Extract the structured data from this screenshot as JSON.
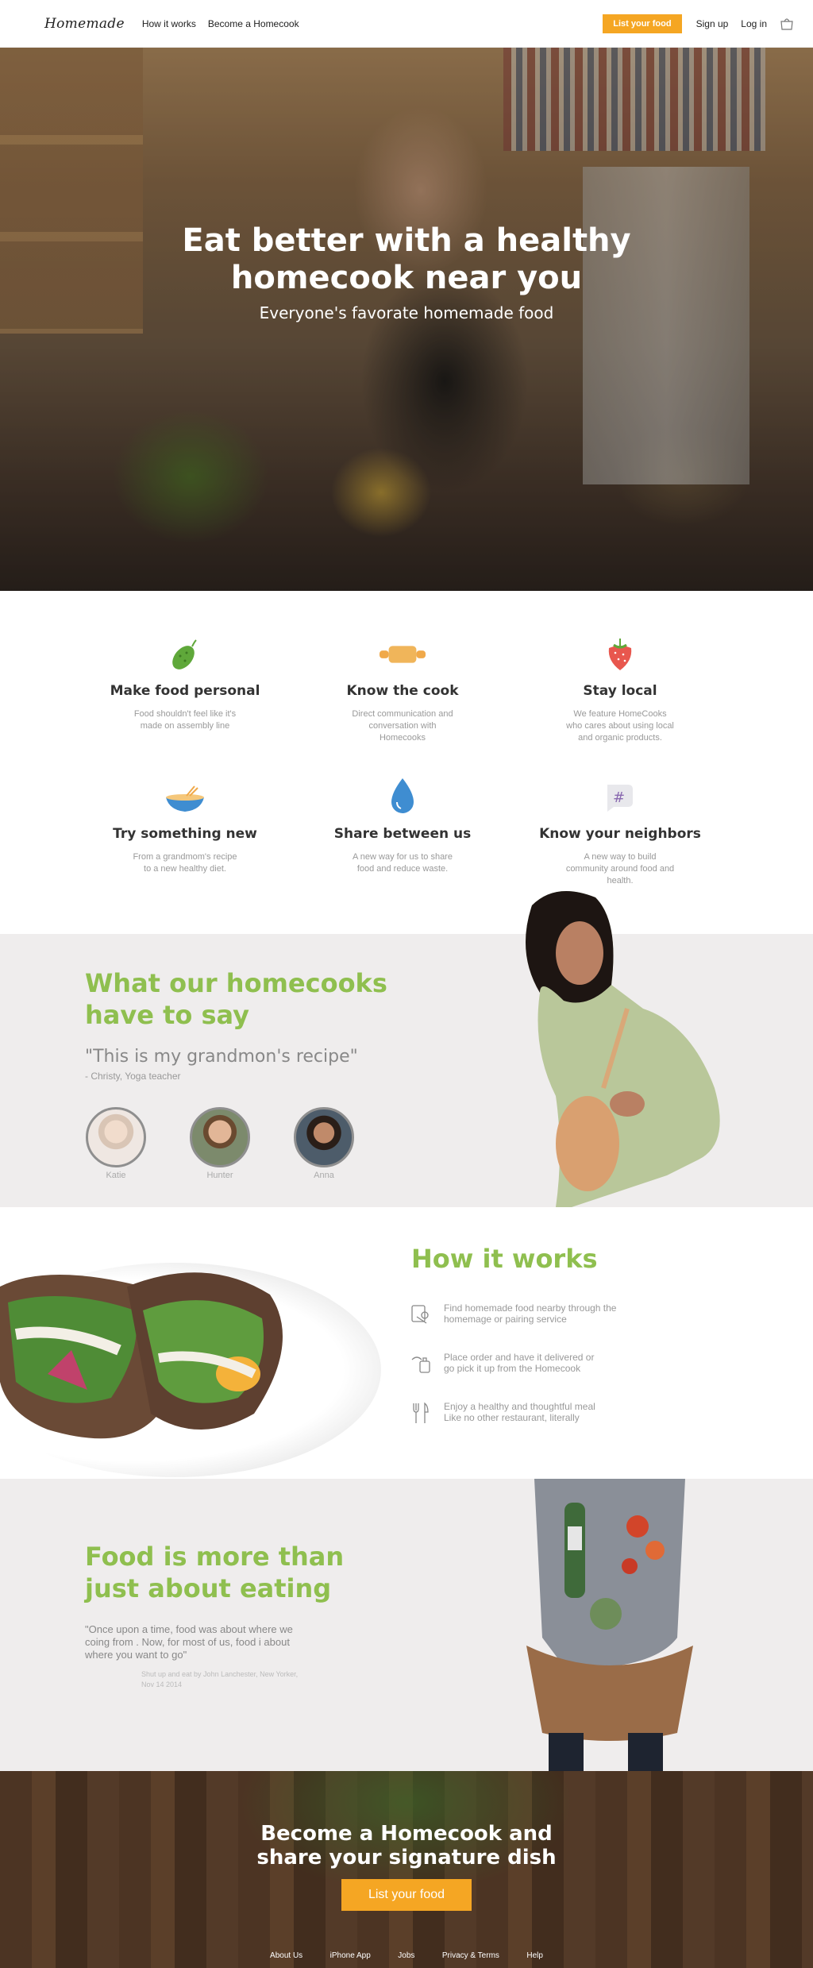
{
  "nav": {
    "logo": "Homemade",
    "links": [
      "How it works",
      "Become a Homecook"
    ],
    "list_button": "List your food",
    "sign_up": "Sign up",
    "log_in": "Log in"
  },
  "hero": {
    "title_line1": "Eat better with a healthy",
    "title_line2": "homecook near you",
    "subtitle": "Everyone's favorate homemade food"
  },
  "features": [
    {
      "icon": "pickle-icon",
      "title": "Make food personal",
      "text": "Food shouldn't feel like it's made on assembly line"
    },
    {
      "icon": "rolling-pin-icon",
      "title": "Know the cook",
      "text": "Direct communication and conversation with Homecooks"
    },
    {
      "icon": "strawberry-icon",
      "title": "Stay local",
      "text": "We feature HomeCooks who cares about using local and organic products."
    },
    {
      "icon": "bowl-icon",
      "title": "Try something new",
      "text": "From a grandmom's recipe to a new healthy diet."
    },
    {
      "icon": "water-drop-icon",
      "title": "Share between us",
      "text": "A new way for us to share food and reduce waste."
    },
    {
      "icon": "hashtag-bubble-icon",
      "title": "Know your neighbors",
      "text": "A new way to build community around food and health."
    }
  ],
  "testimonials": {
    "heading_line1": "What our homecooks",
    "heading_line2": "have to say",
    "quote": "\"This is my grandmon's recipe\"",
    "quote_by": "- Christy, Yoga teacher",
    "people": [
      "Katie",
      "Hunter",
      "Anna"
    ]
  },
  "how_it_works": {
    "heading": "How it works",
    "steps": [
      {
        "line1": "Find homemade food nearby through the",
        "line2": "homemage or pairing service"
      },
      {
        "line1": "Place order and have it delivered or",
        "line2": "go pick it up from the Homecook"
      },
      {
        "line1": "Enjoy a healthy and thoughtful meal",
        "line2": "Like no other restaurant, literally"
      }
    ]
  },
  "food": {
    "heading_line1": "Food is more than",
    "heading_line2": "just about eating",
    "quote": "\"Once upon a time, food was about where we coing from . Now, for most of us, food i about where you want to go\"",
    "cite": "Shut up and eat by John Lanchester, New Yorker, Nov 14 2014"
  },
  "cta": {
    "heading_line1": "Become a Homecook and",
    "heading_line2": "share your signature dish",
    "button": "List your food"
  },
  "footer": {
    "links": [
      "About Us",
      "iPhone App",
      "Jobs",
      "Privacy & Terms",
      "Help"
    ]
  },
  "colors": {
    "accent_orange": "#f5a623",
    "accent_green": "#8fbf4f",
    "section_gray": "#efeded"
  }
}
